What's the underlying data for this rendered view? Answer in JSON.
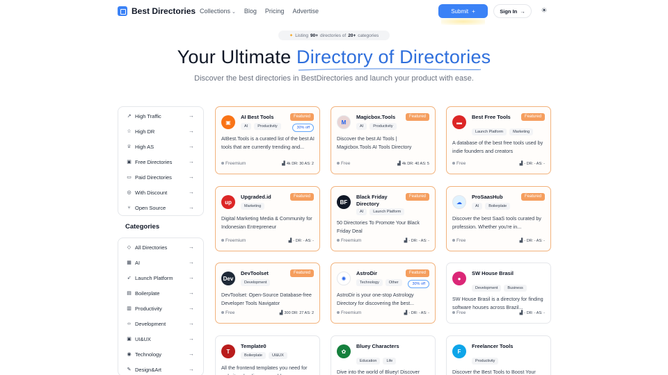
{
  "header": {
    "logo_text": "Best Directories",
    "nav": [
      {
        "label": "Collections",
        "has_dropdown": true
      },
      {
        "label": "Blog"
      },
      {
        "label": "Pricing"
      },
      {
        "label": "Advertise"
      }
    ],
    "submit_label": "Submit",
    "signin_label": "Sign In"
  },
  "hero": {
    "pill": {
      "prefix": "Listing",
      "count": "90+",
      "middle": "directories of",
      "cats": "20+",
      "suffix": "categories"
    },
    "title_start": "Your Ultimate",
    "title_accent": "Directory of Directories",
    "subtitle": "Discover the best directories in BestDirectories and launch your product with ease."
  },
  "sidebar": {
    "filters": [
      {
        "label": "High Traffic",
        "icon": "chart-icon"
      },
      {
        "label": "High DR",
        "icon": "star-icon"
      },
      {
        "label": "High AS",
        "icon": "trophy-icon"
      },
      {
        "label": "Free Directories",
        "icon": "gift-icon"
      },
      {
        "label": "Paid Directories",
        "icon": "money-icon"
      },
      {
        "label": "With Discount",
        "icon": "discount-icon"
      },
      {
        "label": "Open Source",
        "icon": "git-icon"
      }
    ],
    "categories_heading": "Categories",
    "categories": [
      {
        "label": "All Directories",
        "icon": "tag-icon"
      },
      {
        "label": "AI",
        "icon": "ai-icon"
      },
      {
        "label": "Launch Platform",
        "icon": "rocket-icon"
      },
      {
        "label": "Boilerplate",
        "icon": "box-icon"
      },
      {
        "label": "Productivity",
        "icon": "doc-icon"
      },
      {
        "label": "Development",
        "icon": "code-icon"
      },
      {
        "label": "UI&UX",
        "icon": "layout-icon"
      },
      {
        "label": "Technology",
        "icon": "globe-icon"
      },
      {
        "label": "Design&Art",
        "icon": "palette-icon"
      }
    ]
  },
  "cards": [
    {
      "name": "AI Best Tools",
      "featured": true,
      "discount": "30% off",
      "tags": [
        "AI",
        "Productivity"
      ],
      "desc": "AIBest.Tools is a curated list of the best AI tools that are currently trending and...",
      "price": "Freemium",
      "metrics": "4k DR: 30 AS: 2",
      "icon_color": "#f97316",
      "icon_glyph": "▣"
    },
    {
      "name": "Magicbox.Tools",
      "featured": true,
      "tags": [
        "AI",
        "Productivity"
      ],
      "desc": "Discover the best AI Tools | Magicbox.Tools AI Tools Directory",
      "price": "Free",
      "metrics": "4k DR: 40 AS: 5",
      "icon_color": "#e9d5d5",
      "icon_glyph": "M"
    },
    {
      "name": "Best Free Tools",
      "featured": true,
      "tags": [
        "Launch Platform",
        "Marketing"
      ],
      "desc": "A database of the best free tools used by indie founders and creators",
      "price": "Free",
      "metrics": "- DR: - AS: -",
      "icon_color": "#dc2626",
      "icon_glyph": "▬"
    },
    {
      "name": "Upgraded.id",
      "featured": true,
      "tags": [
        "Marketing"
      ],
      "desc": "Digital Marketing Media & Community for Indonesian Entrepreneur",
      "price": "Freemium",
      "metrics": "- DR: - AS: -",
      "icon_color": "#dc2626",
      "icon_glyph": "up"
    },
    {
      "name": "Black Friday Directory",
      "featured": true,
      "tags": [
        "AI",
        "Launch Platform"
      ],
      "desc": "50 Directories To Promote Your Black Friday Deal",
      "price": "Freemium",
      "metrics": "- DR: - AS: -",
      "icon_color": "#111827",
      "icon_glyph": "BF"
    },
    {
      "name": "ProSaasHub",
      "featured": true,
      "tags": [
        "AI",
        "Boilerplate"
      ],
      "desc": "Discover the best SaaS tools curated by profession. Whether you're in...",
      "price": "Free",
      "metrics": "- DR: - AS: -",
      "icon_color": "#e0f2fe",
      "icon_glyph": "☁"
    },
    {
      "name": "DevToolset",
      "featured": true,
      "tags": [
        "Development"
      ],
      "desc": "DevToolset: Open-Source Database-free Developer Tools Navigator",
      "price": "Free",
      "metrics": "300 DR: 27 AS: 2",
      "icon_color": "#1f2937",
      "icon_glyph": "Dev"
    },
    {
      "name": "AstroDir",
      "featured": true,
      "discount": "30% off",
      "tags": [
        "Technology",
        "Other"
      ],
      "desc": "AstroDir is your one-stop Astrology Directory for discovering the best...",
      "price": "Freemium",
      "metrics": "- DR: - AS: -",
      "icon_color": "#ffffff",
      "icon_glyph": "✺"
    },
    {
      "name": "SW House Brasil",
      "featured": false,
      "tags": [
        "Development",
        "Business"
      ],
      "desc": "SW House Brasil is a directory for finding software houses across Brazil...",
      "price": "Free",
      "metrics": "- DR: - AS: -",
      "icon_color": "#db2777",
      "icon_glyph": "●"
    },
    {
      "name": "Template0",
      "featured": false,
      "tags": [
        "Boilerplate",
        "UI&UX"
      ],
      "desc": "All the frontend templates you need for websites, landing pages, blogs...",
      "price": "",
      "metrics": "",
      "icon_color": "#b91c1c",
      "icon_glyph": "T"
    },
    {
      "name": "Bluey Characters",
      "featured": false,
      "tags": [
        "Education",
        "Life"
      ],
      "desc": "Dive into the world of Bluey! Discover character profiles, fun coloring pages...",
      "price": "",
      "metrics": "",
      "icon_color": "#15803d",
      "icon_glyph": "✿"
    },
    {
      "name": "Freelancer Tools",
      "featured": false,
      "tags": [
        "Productivity"
      ],
      "desc": "Discover the Best Tools to Boost Your Freelance Career & Income! Find...",
      "price": "",
      "metrics": "",
      "icon_color": "#0ea5e9",
      "icon_glyph": "F"
    }
  ]
}
